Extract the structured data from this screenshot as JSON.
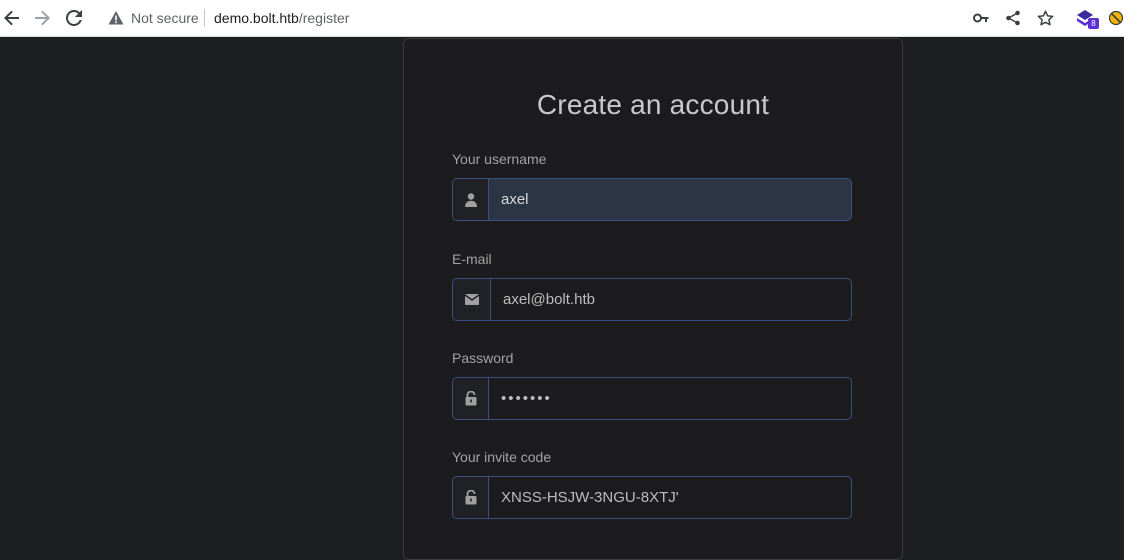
{
  "browser": {
    "security_label": "Not secure",
    "url_domain": "demo.bolt.htb",
    "url_path": "/register",
    "extension_badge": "8"
  },
  "form": {
    "title": "Create an account",
    "username": {
      "label": "Your username",
      "value": "axel",
      "icon": "user-icon"
    },
    "email": {
      "label": "E-mail",
      "value": "axel@bolt.htb",
      "icon": "envelope-icon"
    },
    "password": {
      "label": "Password",
      "value": "•••••••",
      "icon": "unlock-icon"
    },
    "invite": {
      "label": "Your invite code",
      "value": "XNSS-HSJW-3NGU-8XTJ'",
      "icon": "unlock-icon"
    }
  },
  "colors": {
    "page_bg": "#1e1f21",
    "card_bg": "#1c1c1e",
    "input_border": "#3d4f80",
    "focused_input_bg": "#2b3544"
  }
}
